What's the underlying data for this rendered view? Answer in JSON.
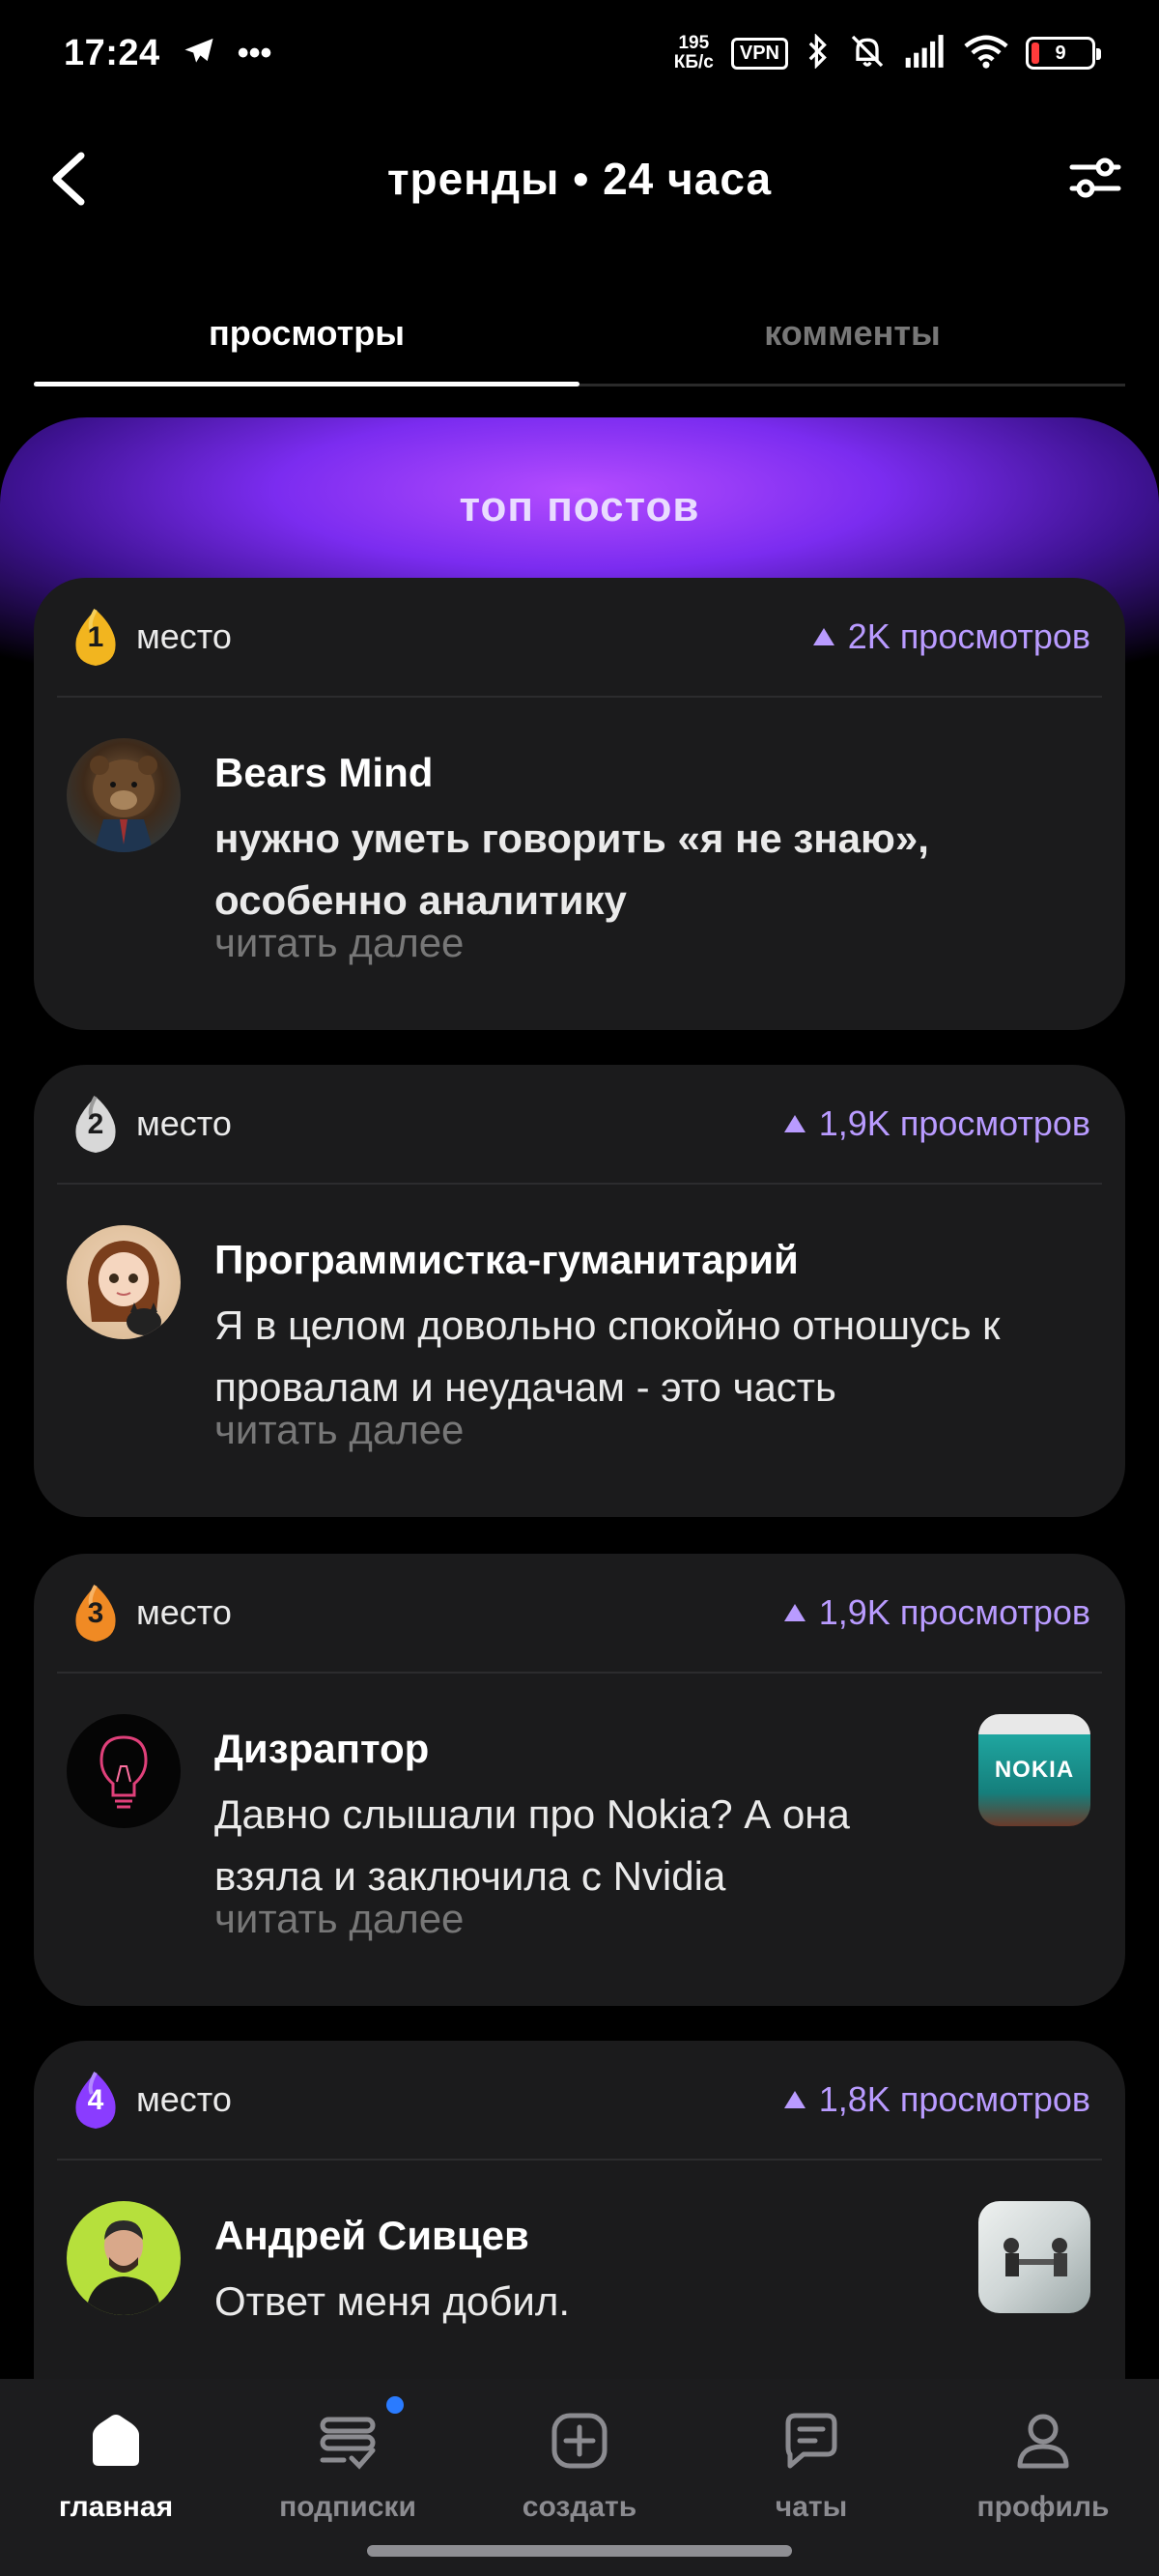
{
  "status_bar": {
    "time": "17:24",
    "net_speed_value": "195",
    "net_speed_unit": "КБ/с",
    "vpn": "VPN",
    "battery": "9",
    "battery_level_percent": 9
  },
  "header": {
    "title": "тренды • 24 часа"
  },
  "tabs": [
    {
      "label": "просмотры",
      "active": true
    },
    {
      "label": "комменты",
      "active": false
    }
  ],
  "top_section": {
    "title": "топ постов"
  },
  "posts": [
    {
      "rank": "1",
      "rank_color": "#f2b51f",
      "place_label": "место",
      "views": "2K просмотров",
      "author": "Bears Mind",
      "text": "нужно уметь говорить «я не знаю», особенно аналитику",
      "read_more": "читать далее",
      "avatar_icon": "bear-avatar",
      "has_thumbnail": false
    },
    {
      "rank": "2",
      "rank_color": "#cfcfcf",
      "place_label": "место",
      "views": "1,9K просмотров",
      "author": "Программистка-гуманитарий",
      "text": "Я в целом довольно спокойно отношусь к провалам и неудачам - это часть",
      "read_more": "читать далее",
      "avatar_icon": "girl-cat-avatar",
      "has_thumbnail": false
    },
    {
      "rank": "3",
      "rank_color": "#f08a24",
      "place_label": "место",
      "views": "1,9K просмотров",
      "author": "Дизраптор",
      "text": "Давно слышали про Nokia? А она взяла и заключила с Nvidia",
      "read_more": "читать далее",
      "avatar_icon": "lightbulb-avatar",
      "has_thumbnail": true,
      "thumbnail_text": "NOKIA"
    },
    {
      "rank": "4",
      "rank_color": "#8a3cff",
      "place_label": "место",
      "views": "1,8K просмотров",
      "author": "Андрей Сивцев",
      "text": "Ответ меня добил.",
      "avatar_icon": "man-avatar",
      "has_thumbnail": true
    }
  ],
  "bottom_nav": [
    {
      "label": "главная",
      "icon": "home-icon",
      "active": true
    },
    {
      "label": "подписки",
      "icon": "subscriptions-icon",
      "active": false,
      "has_notification": true
    },
    {
      "label": "создать",
      "icon": "create-icon",
      "active": false
    },
    {
      "label": "чаты",
      "icon": "chat-icon",
      "active": false
    },
    {
      "label": "профиль",
      "icon": "profile-icon",
      "active": false
    }
  ]
}
